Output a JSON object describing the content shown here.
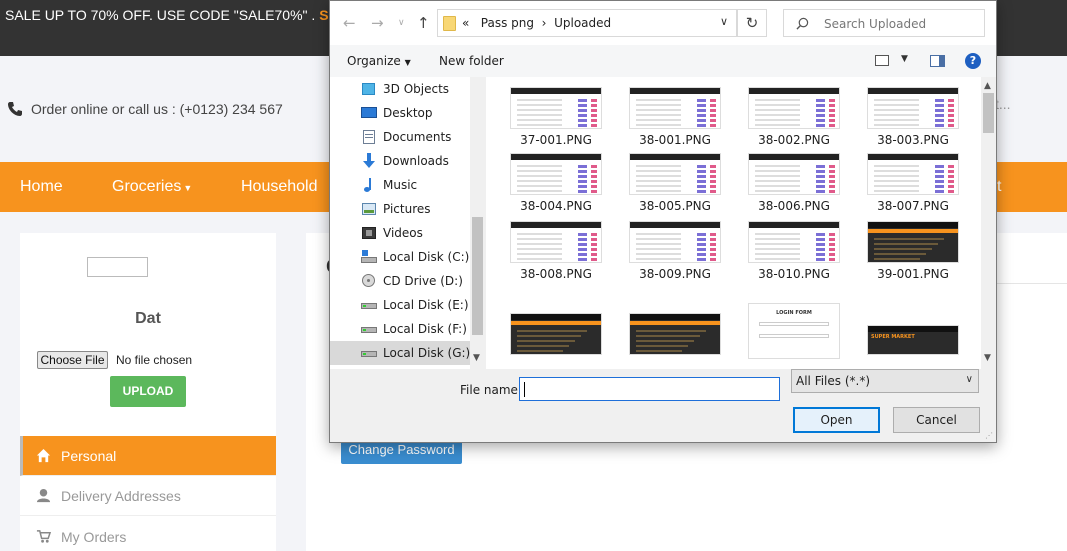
{
  "page": {
    "promo": {
      "text": "SALE UP TO 70% OFF. USE CODE \"SALE70%\" .",
      "code_fragment": "S"
    },
    "contact": {
      "text": "Order online or call us : (+0123) 234 567",
      "icon": "phone-icon"
    },
    "search_placeholder_fragment": "t...",
    "nav": [
      "Home",
      "Groceries",
      "Household",
      "ct"
    ],
    "sidebar": {
      "user_name": "Dat",
      "choose_file_label": "Choose File",
      "no_file_text": "No file chosen",
      "upload_label": "UPLOAD",
      "items": [
        {
          "label": "Personal",
          "icon": "home-icon"
        },
        {
          "label": "Delivery Addresses",
          "icon": "user-icon"
        },
        {
          "label": "My Orders",
          "icon": "cart-icon"
        }
      ]
    },
    "main": {
      "heading_fragment": "C",
      "change_password_label": "Change Password"
    },
    "colors": {
      "accent": "#f7931e",
      "upload_green": "#5cb85c",
      "button_blue": "#3a8dd0",
      "promo_bg": "#333333"
    }
  },
  "dialog": {
    "address": {
      "prefix": "«",
      "crumbs": [
        "Pass png",
        "Uploaded"
      ],
      "separator": "›"
    },
    "search_placeholder": "Search Uploaded",
    "toolbar": {
      "organize_label": "Organize",
      "new_folder_label": "New folder",
      "help_label": "?"
    },
    "tree": [
      {
        "label": "3D Objects",
        "icon": "3d-objects-icon"
      },
      {
        "label": "Desktop",
        "icon": "desktop-icon"
      },
      {
        "label": "Documents",
        "icon": "documents-icon"
      },
      {
        "label": "Downloads",
        "icon": "downloads-icon"
      },
      {
        "label": "Music",
        "icon": "music-icon"
      },
      {
        "label": "Pictures",
        "icon": "pictures-icon"
      },
      {
        "label": "Videos",
        "icon": "videos-icon"
      },
      {
        "label": "Local Disk (C:)",
        "icon": "windows-disk-icon"
      },
      {
        "label": "CD Drive (D:)",
        "icon": "cd-drive-icon"
      },
      {
        "label": "Local Disk (E:)",
        "icon": "disk-icon"
      },
      {
        "label": "Local Disk (F:)",
        "icon": "disk-icon"
      },
      {
        "label": "Local Disk (G:)",
        "icon": "disk-icon",
        "selected": true
      }
    ],
    "files": [
      {
        "name": "37-001.PNG",
        "thumb": "table"
      },
      {
        "name": "38-001.PNG",
        "thumb": "table"
      },
      {
        "name": "38-002.PNG",
        "thumb": "table"
      },
      {
        "name": "38-003.PNG",
        "thumb": "table"
      },
      {
        "name": "38-004.PNG",
        "thumb": "table"
      },
      {
        "name": "38-005.PNG",
        "thumb": "table"
      },
      {
        "name": "38-006.PNG",
        "thumb": "table"
      },
      {
        "name": "38-007.PNG",
        "thumb": "table"
      },
      {
        "name": "38-008.PNG",
        "thumb": "table"
      },
      {
        "name": "38-009.PNG",
        "thumb": "table"
      },
      {
        "name": "38-010.PNG",
        "thumb": "table"
      },
      {
        "name": "39-001.PNG",
        "thumb": "orange"
      },
      {
        "name": "",
        "thumb": "orange"
      },
      {
        "name": "",
        "thumb": "orange"
      },
      {
        "name": "",
        "thumb": "login",
        "thumb_title": "LOGIN FORM"
      },
      {
        "name": "",
        "thumb": "orange",
        "thumb_title": "SUPER MARKET"
      }
    ],
    "file_name_label": "File name:",
    "file_name_value": "",
    "file_type_value": "All Files (*.*)",
    "open_label": "Open",
    "cancel_label": "Cancel"
  }
}
